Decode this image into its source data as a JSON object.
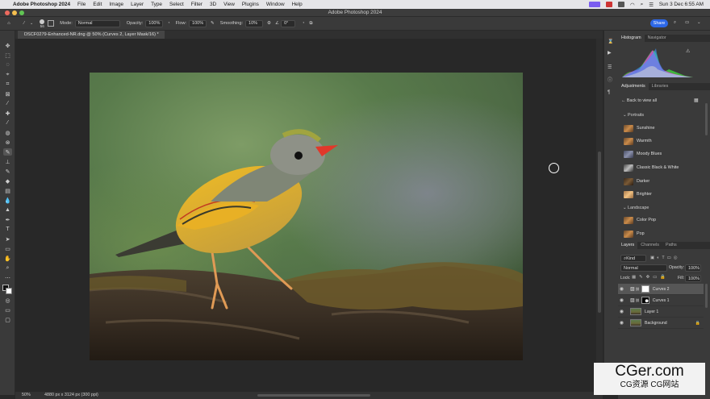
{
  "menubar": {
    "app": "Adobe Photoshop 2024",
    "items": [
      "File",
      "Edit",
      "Image",
      "Layer",
      "Type",
      "Select",
      "Filter",
      "3D",
      "View",
      "Plugins",
      "Window",
      "Help"
    ],
    "clock": "Sun 3 Dec  6:55 AM"
  },
  "window": {
    "title": "Adobe Photoshop 2024"
  },
  "options": {
    "brush_size": "56",
    "mode_label": "Mode:",
    "mode_value": "Normal",
    "opacity_label": "Opacity:",
    "opacity_value": "100%",
    "flow_label": "Flow:",
    "flow_value": "100%",
    "smoothing_label": "Smoothing:",
    "smoothing_value": "10%",
    "angle_value": "0°",
    "share_label": "Share"
  },
  "document": {
    "tab_title": "DSCF0279-Enhanced-NR.dng @ 50% (Curves 2, Layer Mask/16) *"
  },
  "status": {
    "zoom": "50%",
    "info": "4880 px x 3124 px (300 ppi)"
  },
  "panels": {
    "top_tabs": [
      "Histogram",
      "Navigator"
    ],
    "adj_tabs": [
      "Adjustments",
      "Libraries"
    ],
    "back_label": "Back to view all",
    "sections": [
      {
        "name": "Portraits",
        "items": [
          "Sunshine",
          "Warmth",
          "Moody Blues",
          "Classic Black & White",
          "Darker",
          "Brighter"
        ]
      },
      {
        "name": "Landscape",
        "items": [
          "Color Pop",
          "Pop"
        ]
      }
    ],
    "layer_tabs": [
      "Layers",
      "Channels",
      "Paths"
    ],
    "filter_kind": "Kind",
    "blend_mode": "Normal",
    "opacity_label": "Opacity:",
    "opacity_value": "100%",
    "lock_label": "Lock:",
    "fill_label": "Fill:",
    "fill_value": "100%",
    "layers": [
      "Curves 2",
      "Curves 1",
      "Layer 1",
      "Background"
    ]
  },
  "watermark": {
    "line1": "CGer.com",
    "line2": "CG资源  CG网站"
  }
}
